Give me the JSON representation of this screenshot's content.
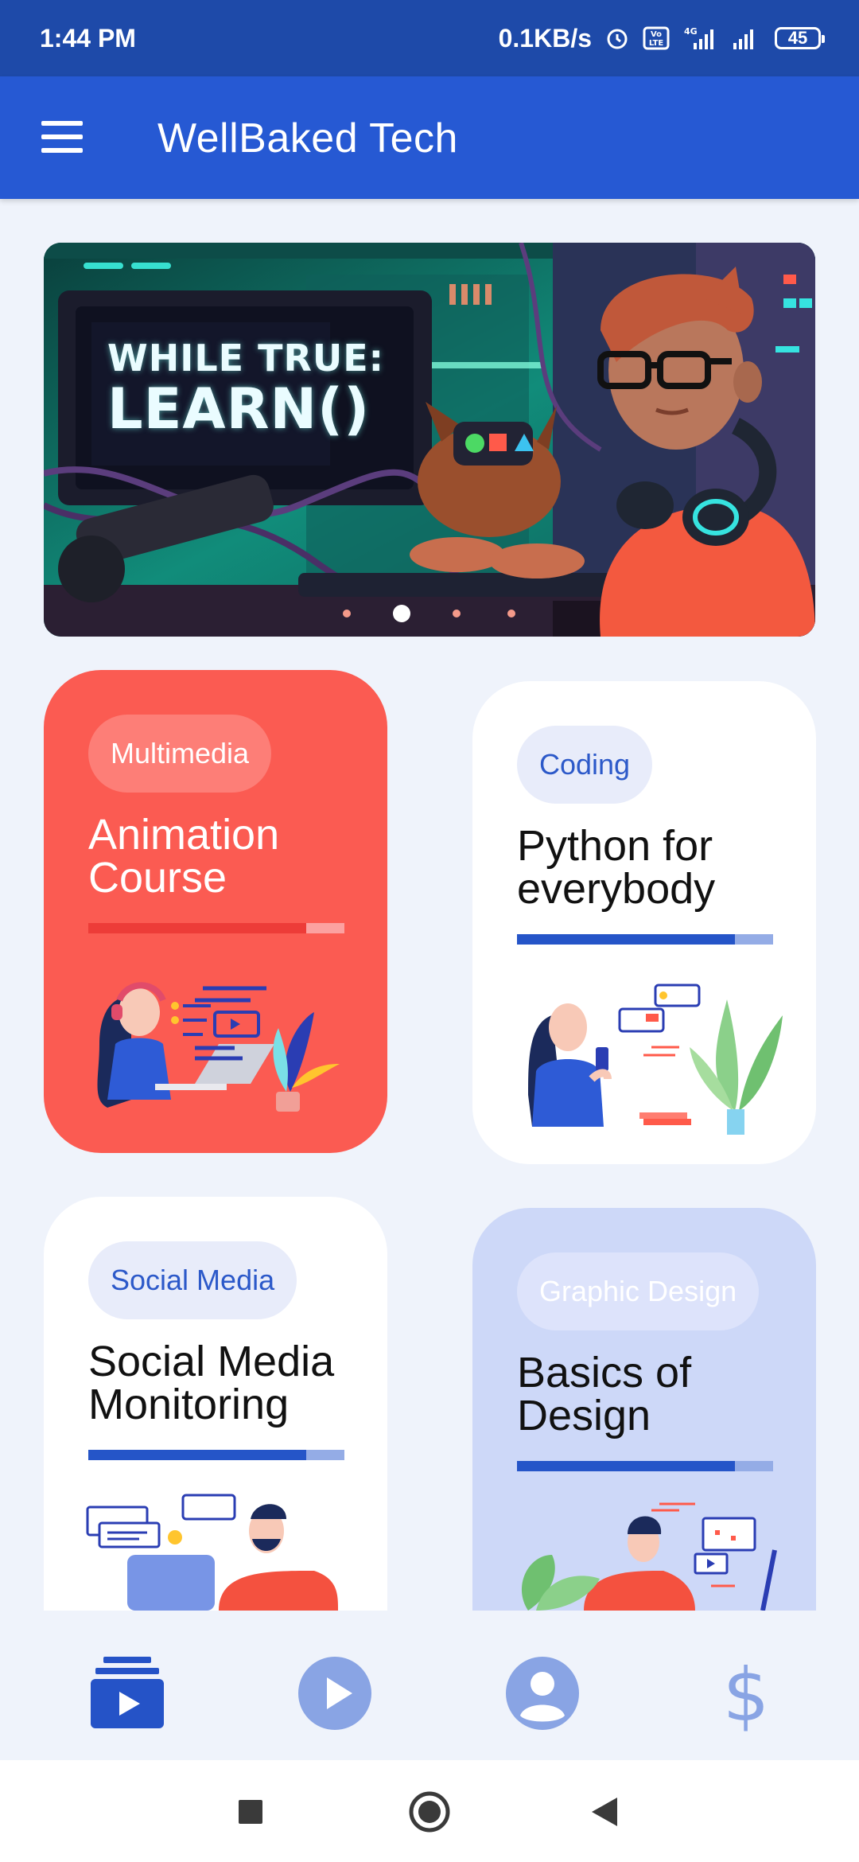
{
  "status_bar": {
    "time": "1:44 PM",
    "network_speed": "0.1KB/s",
    "battery_level": "45",
    "icons": [
      "alarm-icon",
      "volte-icon",
      "signal-4g-icon",
      "signal-icon",
      "battery-icon"
    ]
  },
  "app_bar": {
    "title": "WellBaked Tech",
    "menu_icon": "hamburger-menu-icon"
  },
  "banner": {
    "headline_line1": "WHILE TRUE:",
    "headline_line2": "LEARN()",
    "slide_count": 4,
    "active_slide": 2
  },
  "courses": [
    {
      "category": "Multimedia",
      "title": "Animation Course",
      "progress": 0.85,
      "color": "#fb5b52"
    },
    {
      "category": "Coding",
      "title": "Python for everybody",
      "progress": 0.85,
      "color": "#ffffff"
    },
    {
      "category": "Social Media",
      "title": "Social Media Monitoring",
      "progress": 0.85,
      "color": "#ffffff"
    },
    {
      "category": "Graphic Design",
      "title": "Basics of Design",
      "progress": 0.85,
      "color": "#cdd8f8"
    }
  ],
  "bottom_nav": {
    "items": [
      {
        "icon": "courses-icon",
        "active": true
      },
      {
        "icon": "play-icon",
        "active": false
      },
      {
        "icon": "profile-icon",
        "active": false
      },
      {
        "icon": "dollar-icon",
        "active": false
      }
    ],
    "active_color": "#2553c7",
    "inactive_color": "#89a4e4"
  },
  "system_nav": {
    "icons": [
      "recents-square-icon",
      "home-circle-icon",
      "back-triangle-icon"
    ]
  }
}
